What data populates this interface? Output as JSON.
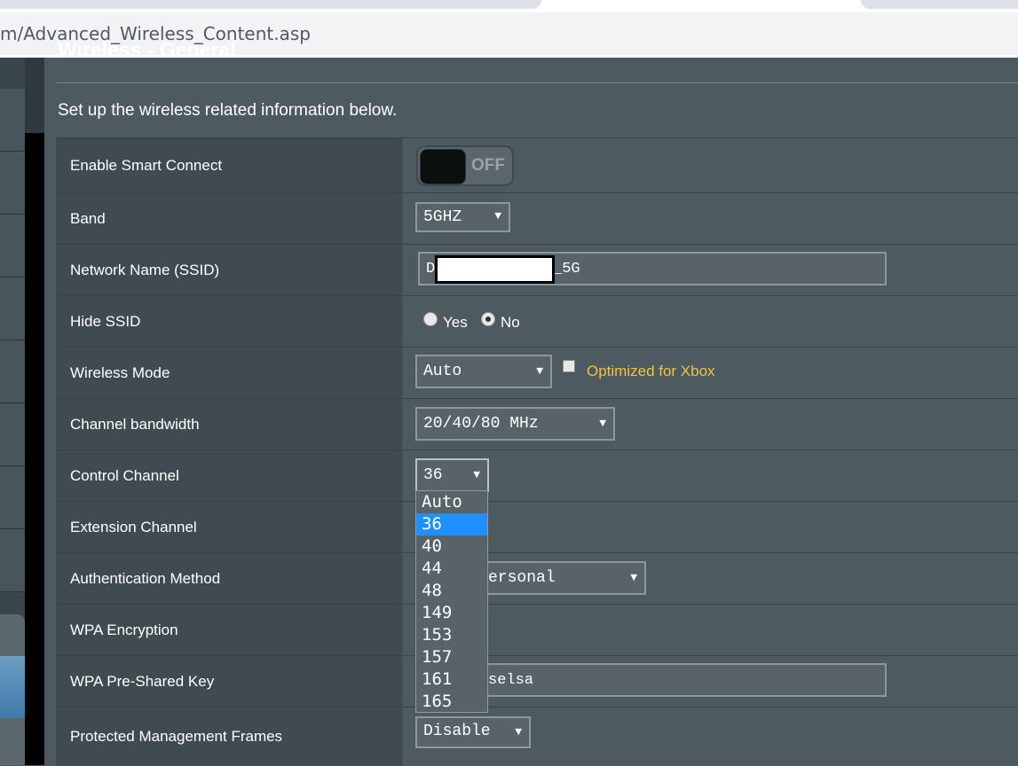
{
  "browser": {
    "url": "m/Advanced_Wireless_Content.asp"
  },
  "page": {
    "section_title": "Wireless - General",
    "description": "Set up the wireless related information below."
  },
  "form": {
    "smart_connect": {
      "label": "Enable Smart Connect",
      "state": "OFF"
    },
    "band": {
      "label": "Band",
      "value": "5GHZ"
    },
    "ssid": {
      "label": "Network Name (SSID)",
      "value_prefix": "D",
      "value_suffix": "_5G"
    },
    "hide_ssid": {
      "label": "Hide SSID",
      "options": [
        "Yes",
        "No"
      ],
      "selected": "No"
    },
    "wireless_mode": {
      "label": "Wireless Mode",
      "value": "Auto",
      "xbox_label": "Optimized for Xbox",
      "xbox_checked": false
    },
    "channel_bandwidth": {
      "label": "Channel bandwidth",
      "value": "20/40/80 MHz"
    },
    "control_channel": {
      "label": "Control Channel",
      "value": "36",
      "options": [
        "Auto",
        "36",
        "40",
        "44",
        "48",
        "149",
        "153",
        "157",
        "161",
        "165"
      ],
      "highlighted": "36"
    },
    "extension_channel": {
      "label": "Extension Channel"
    },
    "auth_method": {
      "label": "Authentication Method",
      "value_visible": "ersonal"
    },
    "wpa_encryption": {
      "label": "WPA Encryption"
    },
    "wpa_psk": {
      "label": "WPA Pre-Shared Key",
      "value_visible": "selsa"
    },
    "pmf": {
      "label": "Protected Management Frames",
      "value": "Disable"
    }
  },
  "colors": {
    "page_bg": "#4d5a60",
    "label_bg": "#3f4b51",
    "accent_highlight": "#1e90ff",
    "xbox_text": "#f5c242"
  }
}
